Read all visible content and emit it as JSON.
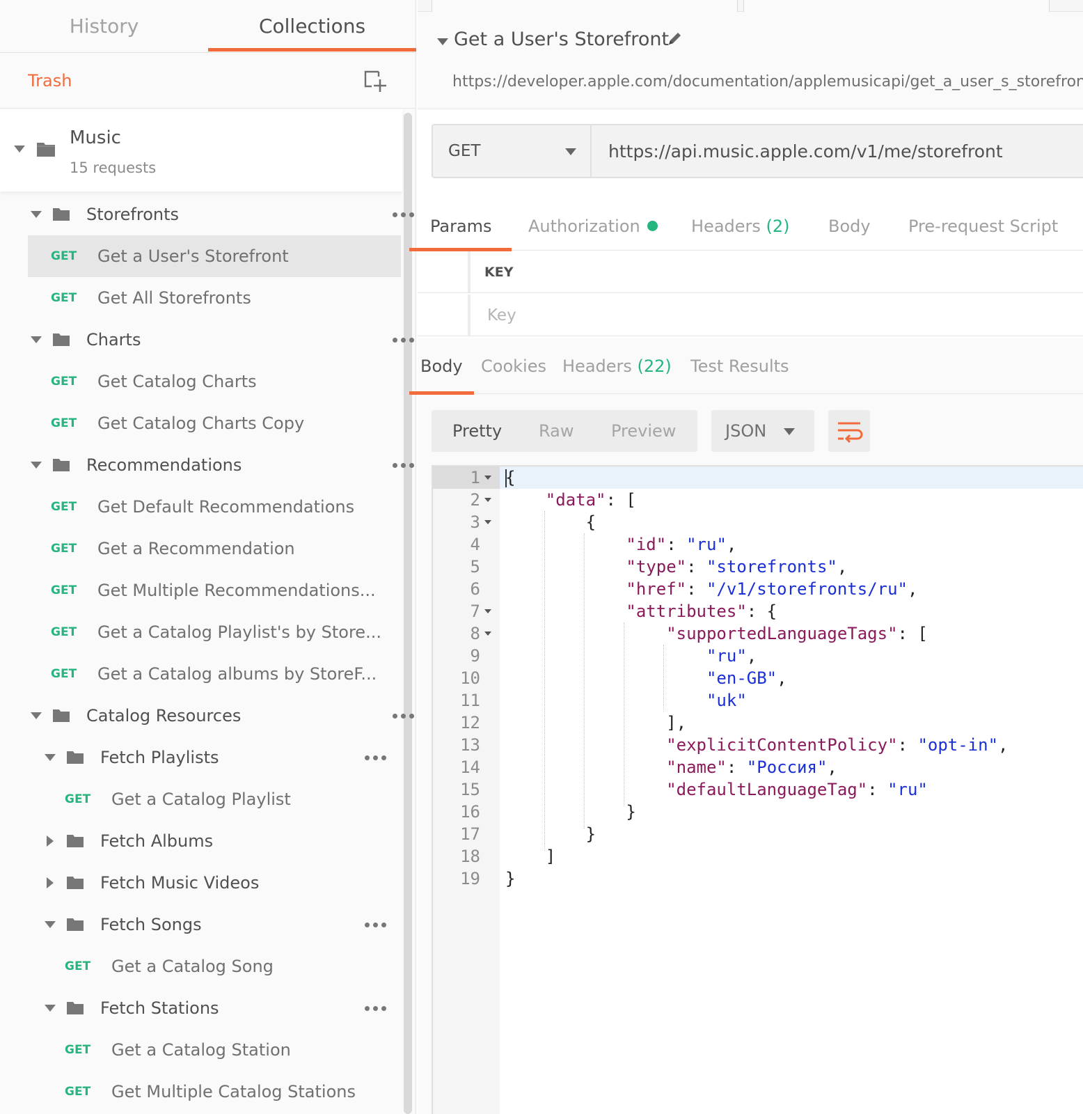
{
  "sidebar": {
    "tabs": {
      "history": "History",
      "collections": "Collections"
    },
    "trash_label": "Trash",
    "new_collection_icon": "new-collection-icon",
    "collection": {
      "name": "Music",
      "count": "15 requests"
    },
    "folders": {
      "storefronts": "Storefronts",
      "charts": "Charts",
      "recommendations": "Recommendations",
      "catalog_resources": "Catalog Resources",
      "fetch_playlists": "Fetch Playlists",
      "fetch_albums": "Fetch Albums",
      "fetch_music_videos": "Fetch Music Videos",
      "fetch_songs": "Fetch Songs",
      "fetch_stations": "Fetch Stations"
    },
    "method_get": "GET",
    "requests": {
      "get_users_storefront": "Get a User's Storefront",
      "get_all_storefronts": "Get All Storefronts",
      "get_catalog_charts": "Get Catalog Charts",
      "get_catalog_charts_copy": "Get Catalog Charts Copy",
      "get_default_recommendations": "Get Default Recommendations",
      "get_a_recommendation": "Get a Recommendation",
      "get_multiple_recommendations": "Get Multiple Recommendations...",
      "get_catalog_playlists_by_store": "Get a Catalog Playlist's by Store...",
      "get_catalog_albums_by_store": "Get a Catalog albums by StoreF...",
      "get_catalog_playlist": "Get a Catalog Playlist",
      "get_catalog_song": "Get a Catalog Song",
      "get_catalog_station": "Get a Catalog Station",
      "get_multiple_catalog_stations": "Get Multiple Catalog Stations"
    }
  },
  "request": {
    "title": "Get a User's Storefront",
    "doc_url": "https://developer.apple.com/documentation/applemusicapi/get_a_user_s_storefront",
    "method": "GET",
    "url": "https://api.music.apple.com/v1/me/storefront",
    "tabs": {
      "params": "Params",
      "authorization": "Authorization",
      "headers": "Headers",
      "headers_count": "(2)",
      "body": "Body",
      "pre_request": "Pre-request Script"
    },
    "params_table": {
      "key_header": "KEY",
      "key_placeholder": "Key"
    }
  },
  "response": {
    "tabs": {
      "body": "Body",
      "cookies": "Cookies",
      "headers": "Headers",
      "headers_count": "(22)",
      "test_results": "Test Results"
    },
    "view_modes": {
      "pretty": "Pretty",
      "raw": "Raw",
      "preview": "Preview"
    },
    "format": "JSON",
    "wrap_icon": "wrap-lines-icon",
    "lines": [
      {
        "n": "1",
        "text": "{"
      },
      {
        "n": "2",
        "text": "    \"data\": ["
      },
      {
        "n": "3",
        "text": "        {"
      },
      {
        "n": "4",
        "text": "            \"id\": \"ru\","
      },
      {
        "n": "5",
        "text": "            \"type\": \"storefronts\","
      },
      {
        "n": "6",
        "text": "            \"href\": \"/v1/storefronts/ru\","
      },
      {
        "n": "7",
        "text": "            \"attributes\": {"
      },
      {
        "n": "8",
        "text": "                \"supportedLanguageTags\": ["
      },
      {
        "n": "9",
        "text": "                    \"ru\","
      },
      {
        "n": "10",
        "text": "                    \"en-GB\","
      },
      {
        "n": "11",
        "text": "                    \"uk\""
      },
      {
        "n": "12",
        "text": "                ],"
      },
      {
        "n": "13",
        "text": "                \"explicitContentPolicy\": \"opt-in\","
      },
      {
        "n": "14",
        "text": "                \"name\": \"Россия\","
      },
      {
        "n": "15",
        "text": "                \"defaultLanguageTag\": \"ru\""
      },
      {
        "n": "16",
        "text": "            }"
      },
      {
        "n": "17",
        "text": "        }"
      },
      {
        "n": "18",
        "text": "    ]"
      },
      {
        "n": "19",
        "text": "}"
      }
    ]
  },
  "colors": {
    "accent": "#f26b3a",
    "get_method": "#26b47f",
    "json_key": "#8a1a5b",
    "json_string": "#1a2fd6"
  }
}
